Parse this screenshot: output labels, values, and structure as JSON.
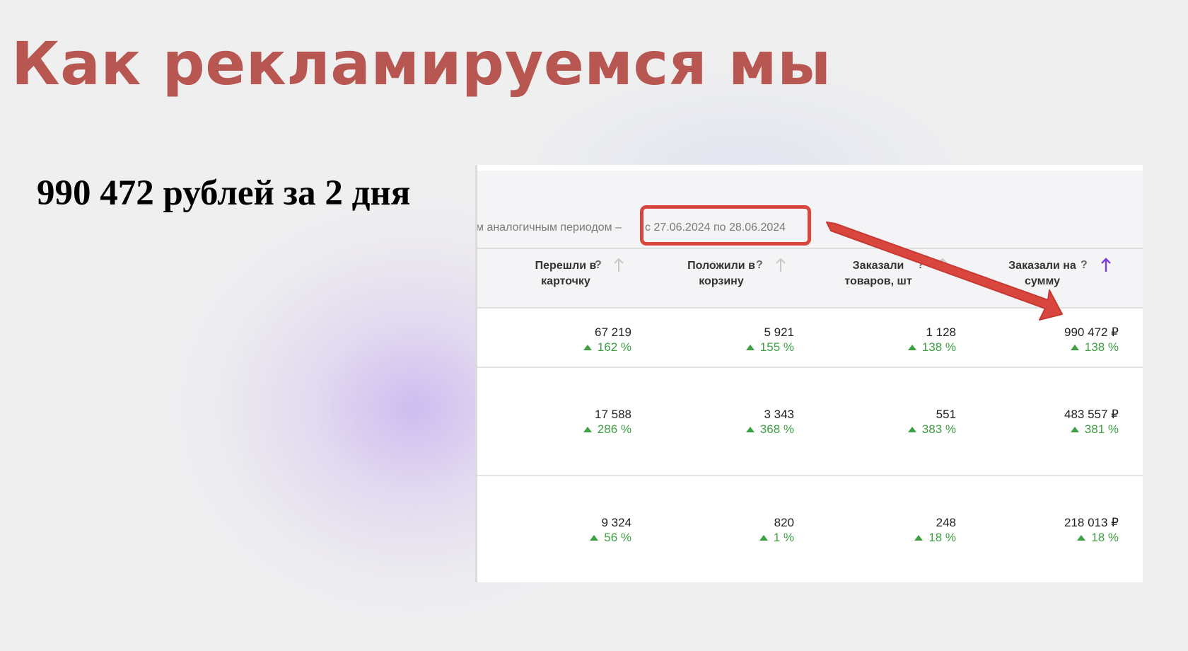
{
  "slide": {
    "title": "Как рекламируемся мы",
    "subtitle": "990 472 рублей за 2 дня"
  },
  "report": {
    "period_prefix": "м аналогичным периодом –",
    "period_range": "с 27.06.2024 по 28.06.2024",
    "columns": [
      {
        "line1": "Перешли в",
        "line2": "карточку",
        "help": "?",
        "sort_active": false
      },
      {
        "line1": "Положили в",
        "line2": "корзину",
        "help": "?",
        "sort_active": false
      },
      {
        "line1": "Заказали",
        "line2": "товаров, шт",
        "help": "?",
        "sort_active": false
      },
      {
        "line1": "Заказали на",
        "line2": "сумму",
        "help": "?",
        "sort_active": true
      }
    ],
    "rows": [
      {
        "cells": [
          {
            "value": "67 219",
            "change": "162 %"
          },
          {
            "value": "5 921",
            "change": "155 %"
          },
          {
            "value": "1 128",
            "change": "138 %"
          },
          {
            "value": "990 472 ₽",
            "change": "138 %"
          }
        ]
      },
      {
        "cells": [
          {
            "value": "17 588",
            "change": "286 %"
          },
          {
            "value": "3 343",
            "change": "368 %"
          },
          {
            "value": "551",
            "change": "383 %"
          },
          {
            "value": "483 557 ₽",
            "change": "381 %"
          }
        ]
      },
      {
        "cells": [
          {
            "value": "9 324",
            "change": "56 %"
          },
          {
            "value": "820",
            "change": "1 %"
          },
          {
            "value": "248",
            "change": "18 %"
          },
          {
            "value": "218 013 ₽",
            "change": "18 %"
          }
        ]
      }
    ]
  },
  "colors": {
    "title": "#b85651",
    "highlight": "#d9463e",
    "positive_change": "#3ea043",
    "sort_active": "#7b3fe4",
    "sort_inactive": "#c8c8c8"
  },
  "icons": {
    "help": "question-mark-icon",
    "sort": "arrow-up-icon",
    "trend": "triangle-up-icon",
    "annotation": "red-arrow-icon"
  }
}
